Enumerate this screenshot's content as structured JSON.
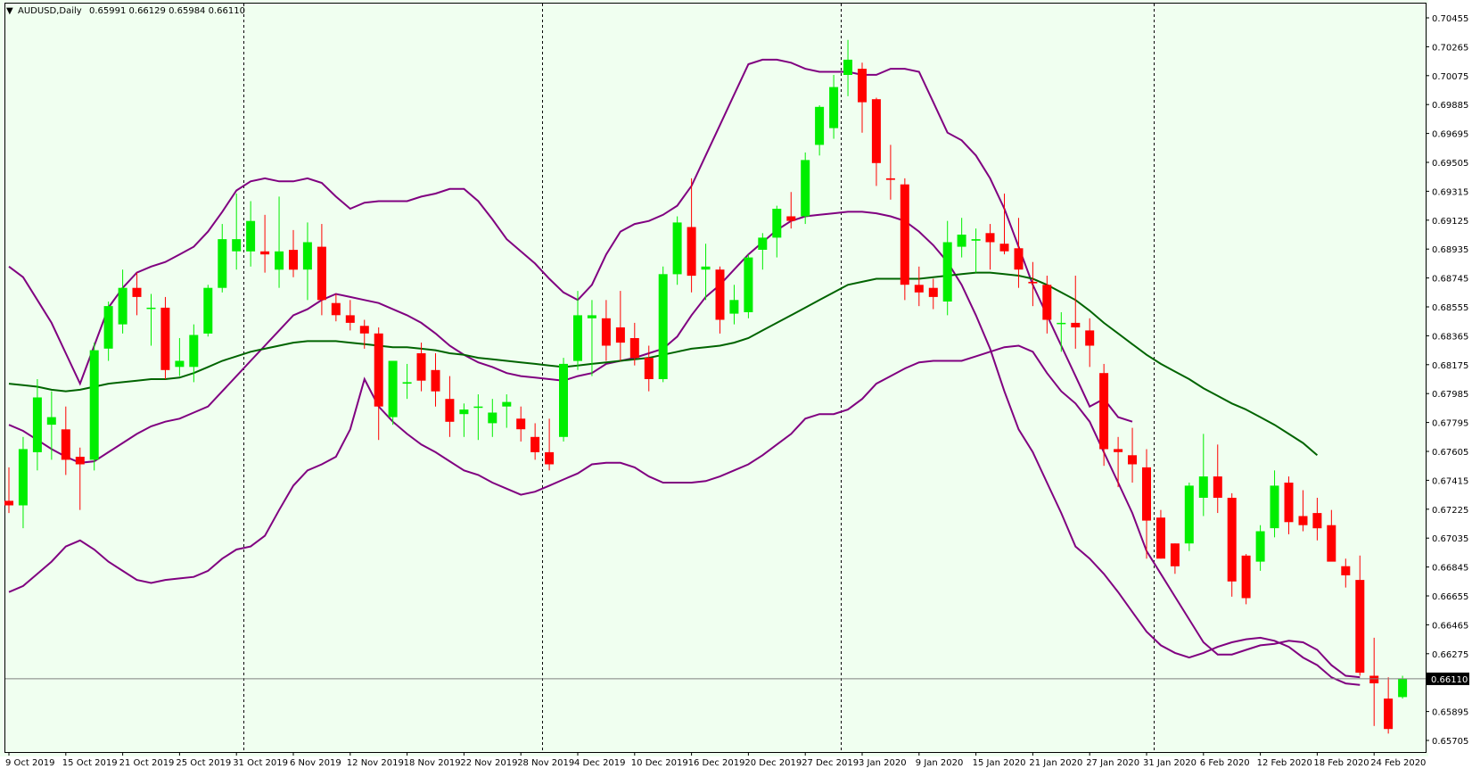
{
  "header": {
    "symbol": "AUDUSD,Daily",
    "ohlc": "0.65991 0.66129 0.65984 0.66110",
    "dropdown_glyph": "▼"
  },
  "colors": {
    "background": "#f0fff0",
    "bull": "#00ee00",
    "bear": "#ff0000",
    "bollinger": "#800080",
    "moving_average": "#006400",
    "grid_separator": "#000000",
    "bid_line": "#808080",
    "price_tag_bg": "#000000"
  },
  "chart_data": {
    "type": "candlestick",
    "symbol": "AUDUSD",
    "timeframe": "Daily",
    "y_axis": {
      "ticks": [
        "0.70455",
        "0.70265",
        "0.70075",
        "0.69885",
        "0.69695",
        "0.69505",
        "0.69315",
        "0.69125",
        "0.68935",
        "0.68745",
        "0.68555",
        "0.68365",
        "0.68175",
        "0.67985",
        "0.67795",
        "0.67605",
        "0.67415",
        "0.67225",
        "0.67035",
        "0.66845",
        "0.66655",
        "0.66465",
        "0.66275",
        "0.65895",
        "0.65705"
      ],
      "range": [
        0.65705,
        0.70455
      ],
      "current_price": "0.66110"
    },
    "x_axis": {
      "labels": [
        "9 Oct 2019",
        "15 Oct 2019",
        "21 Oct 2019",
        "25 Oct 2019",
        "31 Oct 2019",
        "6 Nov 2019",
        "12 Nov 2019",
        "18 Nov 2019",
        "22 Nov 2019",
        "28 Nov 2019",
        "4 Dec 2019",
        "10 Dec 2019",
        "16 Dec 2019",
        "20 Dec 2019",
        "27 Dec 2019",
        "3 Jan 2020",
        "9 Jan 2020",
        "15 Jan 2020",
        "21 Jan 2020",
        "27 Jan 2020",
        "31 Jan 2020",
        "6 Feb 2020",
        "12 Feb 2020",
        "18 Feb 2020",
        "24 Feb 2020"
      ],
      "label_bar_index": [
        0,
        4,
        8,
        12,
        16,
        20,
        24,
        28,
        32,
        36,
        40,
        44,
        48,
        52,
        56,
        60,
        64,
        68,
        72,
        76,
        80,
        84,
        88,
        92,
        96
      ],
      "separators_after_label": [
        "31 Oct 2019",
        "28 Nov 2019",
        "27 Dec 2019",
        "31 Jan 2020"
      ],
      "separator_bar_index": [
        16.5,
        37.5,
        58.5,
        80.5
      ]
    },
    "candles": [
      {
        "o": 0.6728,
        "h": 0.675,
        "l": 0.672,
        "c": 0.6725
      },
      {
        "o": 0.6725,
        "h": 0.677,
        "l": 0.671,
        "c": 0.6762
      },
      {
        "o": 0.676,
        "h": 0.6808,
        "l": 0.6748,
        "c": 0.6796
      },
      {
        "o": 0.6778,
        "h": 0.68,
        "l": 0.6755,
        "c": 0.6783
      },
      {
        "o": 0.6775,
        "h": 0.679,
        "l": 0.6745,
        "c": 0.6755
      },
      {
        "o": 0.6757,
        "h": 0.6763,
        "l": 0.6722,
        "c": 0.6752
      },
      {
        "o": 0.6755,
        "h": 0.6832,
        "l": 0.6748,
        "c": 0.6827
      },
      {
        "o": 0.6828,
        "h": 0.6859,
        "l": 0.682,
        "c": 0.6856
      },
      {
        "o": 0.6844,
        "h": 0.688,
        "l": 0.6838,
        "c": 0.6868
      },
      {
        "o": 0.6868,
        "h": 0.6878,
        "l": 0.685,
        "c": 0.6862
      },
      {
        "o": 0.6855,
        "h": 0.6864,
        "l": 0.683,
        "c": 0.6855
      },
      {
        "o": 0.6855,
        "h": 0.6862,
        "l": 0.6808,
        "c": 0.6814
      },
      {
        "o": 0.6816,
        "h": 0.6835,
        "l": 0.681,
        "c": 0.682
      },
      {
        "o": 0.6816,
        "h": 0.6844,
        "l": 0.6806,
        "c": 0.6837
      },
      {
        "o": 0.6838,
        "h": 0.687,
        "l": 0.6836,
        "c": 0.6868
      },
      {
        "o": 0.6868,
        "h": 0.691,
        "l": 0.6865,
        "c": 0.69
      },
      {
        "o": 0.6892,
        "h": 0.693,
        "l": 0.688,
        "c": 0.69
      },
      {
        "o": 0.6892,
        "h": 0.6925,
        "l": 0.6882,
        "c": 0.6912
      },
      {
        "o": 0.6892,
        "h": 0.6916,
        "l": 0.6878,
        "c": 0.689
      },
      {
        "o": 0.688,
        "h": 0.6928,
        "l": 0.6868,
        "c": 0.6892
      },
      {
        "o": 0.6893,
        "h": 0.6906,
        "l": 0.6875,
        "c": 0.688
      },
      {
        "o": 0.688,
        "h": 0.6911,
        "l": 0.686,
        "c": 0.6898
      },
      {
        "o": 0.6895,
        "h": 0.691,
        "l": 0.685,
        "c": 0.686
      },
      {
        "o": 0.6858,
        "h": 0.6864,
        "l": 0.6846,
        "c": 0.685
      },
      {
        "o": 0.685,
        "h": 0.686,
        "l": 0.684,
        "c": 0.6845
      },
      {
        "o": 0.6843,
        "h": 0.6847,
        "l": 0.6828,
        "c": 0.6838
      },
      {
        "o": 0.6838,
        "h": 0.6842,
        "l": 0.6768,
        "c": 0.679
      },
      {
        "o": 0.6783,
        "h": 0.682,
        "l": 0.6778,
        "c": 0.682
      },
      {
        "o": 0.6805,
        "h": 0.6818,
        "l": 0.6795,
        "c": 0.6806
      },
      {
        "o": 0.6825,
        "h": 0.6832,
        "l": 0.68,
        "c": 0.6807
      },
      {
        "o": 0.6814,
        "h": 0.6825,
        "l": 0.679,
        "c": 0.68
      },
      {
        "o": 0.6795,
        "h": 0.681,
        "l": 0.677,
        "c": 0.678
      },
      {
        "o": 0.6785,
        "h": 0.6792,
        "l": 0.677,
        "c": 0.6788
      },
      {
        "o": 0.679,
        "h": 0.6798,
        "l": 0.6768,
        "c": 0.679
      },
      {
        "o": 0.6779,
        "h": 0.6795,
        "l": 0.677,
        "c": 0.6786
      },
      {
        "o": 0.679,
        "h": 0.6798,
        "l": 0.6776,
        "c": 0.6793
      },
      {
        "o": 0.6782,
        "h": 0.679,
        "l": 0.6767,
        "c": 0.6775
      },
      {
        "o": 0.677,
        "h": 0.6779,
        "l": 0.6755,
        "c": 0.676
      },
      {
        "o": 0.676,
        "h": 0.6782,
        "l": 0.6748,
        "c": 0.6752
      },
      {
        "o": 0.677,
        "h": 0.6822,
        "l": 0.6767,
        "c": 0.6818
      },
      {
        "o": 0.682,
        "h": 0.6866,
        "l": 0.6814,
        "c": 0.685
      },
      {
        "o": 0.6848,
        "h": 0.686,
        "l": 0.681,
        "c": 0.685
      },
      {
        "o": 0.6848,
        "h": 0.686,
        "l": 0.682,
        "c": 0.683
      },
      {
        "o": 0.6842,
        "h": 0.6866,
        "l": 0.682,
        "c": 0.6832
      },
      {
        "o": 0.6835,
        "h": 0.6845,
        "l": 0.6817,
        "c": 0.6822
      },
      {
        "o": 0.6822,
        "h": 0.683,
        "l": 0.68,
        "c": 0.6808
      },
      {
        "o": 0.6808,
        "h": 0.6882,
        "l": 0.6806,
        "c": 0.6877
      },
      {
        "o": 0.6877,
        "h": 0.6915,
        "l": 0.687,
        "c": 0.6911
      },
      {
        "o": 0.6908,
        "h": 0.694,
        "l": 0.6865,
        "c": 0.6876
      },
      {
        "o": 0.688,
        "h": 0.6897,
        "l": 0.686,
        "c": 0.6882
      },
      {
        "o": 0.688,
        "h": 0.6882,
        "l": 0.6838,
        "c": 0.6847
      },
      {
        "o": 0.6851,
        "h": 0.687,
        "l": 0.6844,
        "c": 0.686
      },
      {
        "o": 0.6852,
        "h": 0.689,
        "l": 0.6848,
        "c": 0.6888
      },
      {
        "o": 0.6893,
        "h": 0.6904,
        "l": 0.688,
        "c": 0.6901
      },
      {
        "o": 0.6901,
        "h": 0.6922,
        "l": 0.6888,
        "c": 0.692
      },
      {
        "o": 0.6915,
        "h": 0.6931,
        "l": 0.6907,
        "c": 0.6912
      },
      {
        "o": 0.6915,
        "h": 0.6957,
        "l": 0.691,
        "c": 0.6952
      },
      {
        "o": 0.6962,
        "h": 0.6988,
        "l": 0.6955,
        "c": 0.6987
      },
      {
        "o": 0.6973,
        "h": 0.7008,
        "l": 0.6966,
        "c": 0.7
      },
      {
        "o": 0.7008,
        "h": 0.7031,
        "l": 0.6994,
        "c": 0.7018
      },
      {
        "o": 0.7012,
        "h": 0.7016,
        "l": 0.697,
        "c": 0.699
      },
      {
        "o": 0.6992,
        "h": 0.6993,
        "l": 0.6935,
        "c": 0.695
      },
      {
        "o": 0.694,
        "h": 0.6962,
        "l": 0.6926,
        "c": 0.6939
      },
      {
        "o": 0.6936,
        "h": 0.694,
        "l": 0.686,
        "c": 0.687
      },
      {
        "o": 0.687,
        "h": 0.6882,
        "l": 0.6856,
        "c": 0.6865
      },
      {
        "o": 0.6868,
        "h": 0.6874,
        "l": 0.6854,
        "c": 0.6862
      },
      {
        "o": 0.6859,
        "h": 0.6912,
        "l": 0.685,
        "c": 0.6898
      },
      {
        "o": 0.6895,
        "h": 0.6914,
        "l": 0.6888,
        "c": 0.6903
      },
      {
        "o": 0.6899,
        "h": 0.6907,
        "l": 0.6878,
        "c": 0.69
      },
      {
        "o": 0.6904,
        "h": 0.691,
        "l": 0.688,
        "c": 0.6898
      },
      {
        "o": 0.6897,
        "h": 0.693,
        "l": 0.689,
        "c": 0.6892
      },
      {
        "o": 0.6894,
        "h": 0.6914,
        "l": 0.6868,
        "c": 0.688
      },
      {
        "o": 0.6872,
        "h": 0.6885,
        "l": 0.6856,
        "c": 0.6871
      },
      {
        "o": 0.687,
        "h": 0.6876,
        "l": 0.6838,
        "c": 0.6847
      },
      {
        "o": 0.6845,
        "h": 0.6852,
        "l": 0.6826,
        "c": 0.6845
      },
      {
        "o": 0.6845,
        "h": 0.6876,
        "l": 0.6828,
        "c": 0.6842
      },
      {
        "o": 0.684,
        "h": 0.6848,
        "l": 0.6816,
        "c": 0.683
      },
      {
        "o": 0.6812,
        "h": 0.6818,
        "l": 0.6751,
        "c": 0.6762
      },
      {
        "o": 0.6762,
        "h": 0.677,
        "l": 0.6737,
        "c": 0.676
      },
      {
        "o": 0.6758,
        "h": 0.6776,
        "l": 0.674,
        "c": 0.6752
      },
      {
        "o": 0.675,
        "h": 0.6762,
        "l": 0.669,
        "c": 0.6715
      },
      {
        "o": 0.6717,
        "h": 0.6722,
        "l": 0.669,
        "c": 0.669
      },
      {
        "o": 0.67,
        "h": 0.67,
        "l": 0.668,
        "c": 0.6685
      },
      {
        "o": 0.67,
        "h": 0.674,
        "l": 0.6695,
        "c": 0.6738
      },
      {
        "o": 0.673,
        "h": 0.6772,
        "l": 0.6718,
        "c": 0.6744
      },
      {
        "o": 0.6744,
        "h": 0.6765,
        "l": 0.672,
        "c": 0.673
      },
      {
        "o": 0.673,
        "h": 0.6733,
        "l": 0.6665,
        "c": 0.6675
      },
      {
        "o": 0.6692,
        "h": 0.6693,
        "l": 0.666,
        "c": 0.6664
      },
      {
        "o": 0.6688,
        "h": 0.6712,
        "l": 0.6682,
        "c": 0.6708
      },
      {
        "o": 0.671,
        "h": 0.6748,
        "l": 0.6704,
        "c": 0.6738
      },
      {
        "o": 0.674,
        "h": 0.6744,
        "l": 0.6706,
        "c": 0.6714
      },
      {
        "o": 0.6718,
        "h": 0.6735,
        "l": 0.6708,
        "c": 0.6712
      },
      {
        "o": 0.672,
        "h": 0.673,
        "l": 0.6702,
        "c": 0.671
      },
      {
        "o": 0.6712,
        "h": 0.6722,
        "l": 0.669,
        "c": 0.6688
      },
      {
        "o": 0.6685,
        "h": 0.669,
        "l": 0.6671,
        "c": 0.6679
      },
      {
        "o": 0.6676,
        "h": 0.6692,
        "l": 0.6613,
        "c": 0.6615
      },
      {
        "o": 0.6613,
        "h": 0.6638,
        "l": 0.658,
        "c": 0.6608
      },
      {
        "o": 0.6598,
        "h": 0.6612,
        "l": 0.6575,
        "c": 0.6578
      },
      {
        "o": 0.6599,
        "h": 0.6613,
        "l": 0.6598,
        "c": 0.6611
      }
    ],
    "indicators": {
      "bollinger_upper": [
        0.6882,
        0.6875,
        0.686,
        0.6845,
        0.6825,
        0.6805,
        0.683,
        0.6855,
        0.6868,
        0.6878,
        0.6882,
        0.6885,
        0.689,
        0.6895,
        0.6905,
        0.6918,
        0.6932,
        0.6938,
        0.694,
        0.6938,
        0.6938,
        0.694,
        0.6937,
        0.6928,
        0.692,
        0.6924,
        0.6925,
        0.6925,
        0.6925,
        0.6928,
        0.693,
        0.6933,
        0.6933,
        0.6925,
        0.6913,
        0.69,
        0.6892,
        0.6884,
        0.6874,
        0.6865,
        0.686,
        0.687,
        0.689,
        0.6905,
        0.691,
        0.6912,
        0.6916,
        0.6922,
        0.6935,
        0.6955,
        0.6975,
        0.6995,
        0.7015,
        0.7018,
        0.7018,
        0.7016,
        0.7012,
        0.701,
        0.701,
        0.701,
        0.7008,
        0.7008,
        0.7012,
        0.7012,
        0.701,
        0.699,
        0.697,
        0.6965,
        0.6955,
        0.694,
        0.692,
        0.6895,
        0.687,
        0.685,
        0.683,
        0.681,
        0.679,
        0.6795,
        0.6783,
        0.678
      ],
      "bollinger_upper_start_bar": 0,
      "bollinger_middle": [
        0.6805,
        0.6804,
        0.6803,
        0.6801,
        0.68,
        0.6801,
        0.6803,
        0.6805,
        0.6806,
        0.6807,
        0.6808,
        0.6808,
        0.6809,
        0.6812,
        0.6816,
        0.682,
        0.6823,
        0.6826,
        0.6828,
        0.683,
        0.6832,
        0.6833,
        0.6833,
        0.6833,
        0.6832,
        0.6831,
        0.683,
        0.6829,
        0.6829,
        0.6828,
        0.6827,
        0.6825,
        0.6824,
        0.6822,
        0.6821,
        0.682,
        0.6819,
        0.6818,
        0.6817,
        0.6816,
        0.6817,
        0.6818,
        0.6819,
        0.682,
        0.6821,
        0.6822,
        0.6824,
        0.6826,
        0.6828,
        0.6829,
        0.683,
        0.6832,
        0.6835,
        0.684,
        0.6845,
        0.685,
        0.6855,
        0.686,
        0.6865,
        0.687,
        0.6872,
        0.6874,
        0.6874,
        0.6874,
        0.6874,
        0.6875,
        0.6876,
        0.6877,
        0.6878,
        0.6878,
        0.6877,
        0.6876,
        0.6874,
        0.687,
        0.6865,
        0.686,
        0.6853,
        0.6845,
        0.6838,
        0.6831,
        0.6824,
        0.6818,
        0.6813,
        0.6808,
        0.6802,
        0.6797,
        0.6792,
        0.6788,
        0.6783,
        0.6778,
        0.6772,
        0.6766,
        0.6758
      ],
      "bollinger_lower": [
        0.6668,
        0.6672,
        0.668,
        0.6688,
        0.6698,
        0.6702,
        0.6696,
        0.6688,
        0.6682,
        0.6676,
        0.6674,
        0.6676,
        0.6677,
        0.6678,
        0.6682,
        0.669,
        0.6696,
        0.6698,
        0.6705,
        0.6722,
        0.6738,
        0.6748,
        0.6752,
        0.6757,
        0.6775,
        0.6808,
        0.679,
        0.678,
        0.6772,
        0.6765,
        0.676,
        0.6754,
        0.6748,
        0.6745,
        0.674,
        0.6736,
        0.6732,
        0.6734,
        0.6738,
        0.6742,
        0.6746,
        0.6752,
        0.6753,
        0.6753,
        0.675,
        0.6744,
        0.674,
        0.674,
        0.674,
        0.6741,
        0.6744,
        0.6748,
        0.6752,
        0.6758,
        0.6765,
        0.6772,
        0.6782,
        0.6785,
        0.6785,
        0.6788,
        0.6795,
        0.6805,
        0.681,
        0.6815,
        0.6819,
        0.682,
        0.682,
        0.682,
        0.6823,
        0.6826,
        0.6829,
        0.683,
        0.6826,
        0.6812,
        0.68,
        0.6792,
        0.678,
        0.676,
        0.674,
        0.672,
        0.6695,
        0.668,
        0.6665,
        0.665,
        0.6635,
        0.6627,
        0.6627,
        0.663,
        0.6633,
        0.6634,
        0.6636,
        0.6635,
        0.663,
        0.662,
        0.6613,
        0.6612
      ],
      "bollinger_lower_start_bar": 0,
      "mid_band": [
        0.6778,
        0.6774,
        0.6768,
        0.6762,
        0.6757,
        0.6753,
        0.6754,
        0.676,
        0.6766,
        0.6772,
        0.6777,
        0.678,
        0.6782,
        0.6786,
        0.679,
        0.68,
        0.681,
        0.682,
        0.683,
        0.684,
        0.685,
        0.6854,
        0.686,
        0.6864,
        0.6862,
        0.686,
        0.6858,
        0.6854,
        0.685,
        0.6845,
        0.6838,
        0.683,
        0.6824,
        0.6819,
        0.6816,
        0.6812,
        0.681,
        0.6809,
        0.6808,
        0.6807,
        0.681,
        0.6812,
        0.6818,
        0.682,
        0.6822,
        0.6825,
        0.6828,
        0.6836,
        0.685,
        0.6862,
        0.687,
        0.688,
        0.689,
        0.6898,
        0.6906,
        0.6912,
        0.6915,
        0.6916,
        0.6917,
        0.6918,
        0.6918,
        0.6917,
        0.6915,
        0.6912,
        0.6905,
        0.6896,
        0.6885,
        0.687,
        0.685,
        0.6828,
        0.68,
        0.6775,
        0.676,
        0.674,
        0.672,
        0.6698,
        0.669,
        0.668,
        0.6668,
        0.6655,
        0.6642,
        0.6633,
        0.6628,
        0.6625,
        0.6628,
        0.6632,
        0.6635,
        0.6637,
        0.6638,
        0.6636,
        0.6632,
        0.6625,
        0.662,
        0.6612,
        0.6608,
        0.6607
      ]
    }
  }
}
